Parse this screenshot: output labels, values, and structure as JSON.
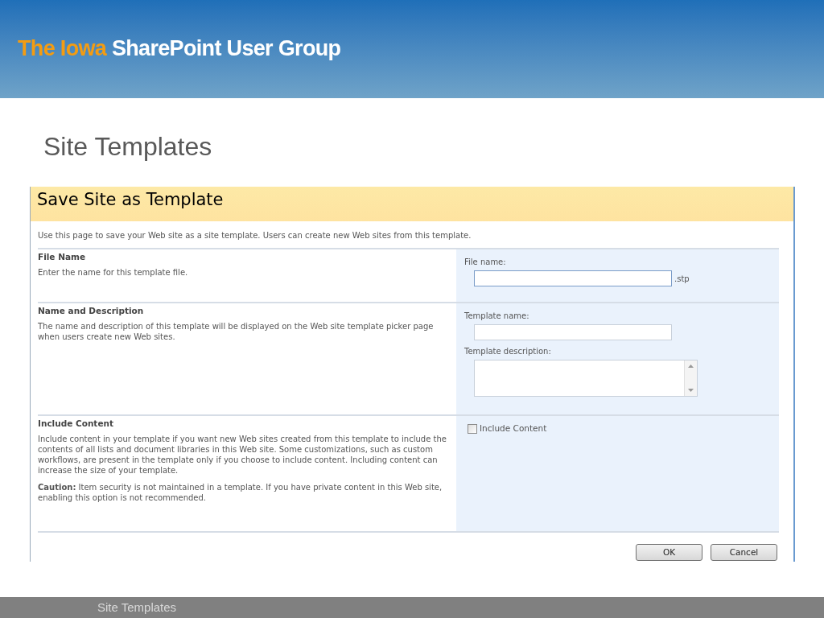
{
  "header": {
    "brand_highlight": "The Iowa",
    "brand_rest": "SharePoint User Group"
  },
  "slide_title": "Site Templates",
  "screenshot": {
    "page_title": "Save Site as Template",
    "intro": "Use this page to save your Web site as a site template. Users can create new Web sites from this template.",
    "sections": [
      {
        "title": "File Name",
        "paragraphs": [
          "Enter the name for this template file."
        ],
        "fields": [
          {
            "kind": "text",
            "label": "File name:",
            "suffix": ".stp"
          }
        ]
      },
      {
        "title": "Name and Description",
        "paragraphs": [
          "The name and description of this template will be displayed on the Web site template picker page when users create new Web sites."
        ],
        "fields": [
          {
            "kind": "text",
            "label": "Template name:"
          },
          {
            "kind": "textarea",
            "label": "Template description:"
          }
        ]
      },
      {
        "title": "Include Content",
        "paragraphs": [
          "Include content in your template if you want new Web sites created from this template to include the contents of all lists and document libraries in this Web site. Some customizations, such as custom workflows, are present in the template only if you choose to include content. Including content can increase the size of your template.",
          "**Caution:** Item security is not maintained in a template. If you have private content in this Web site, enabling this option is not recommended."
        ],
        "fields": [
          {
            "kind": "checkbox",
            "label": "Include Content",
            "checked": false
          }
        ]
      }
    ],
    "buttons": [
      "OK",
      "Cancel"
    ]
  },
  "footer": "Site Templates"
}
